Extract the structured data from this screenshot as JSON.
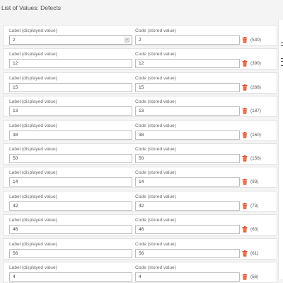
{
  "page": {
    "title": "List of Values: Defects"
  },
  "fields": {
    "label_caption": "Label (displayed value)",
    "code_caption": "Code (stored value)"
  },
  "colors": {
    "delete_icon": "#e0481f",
    "input_border": "#bdbdbd",
    "background": "#f4f4f4"
  },
  "rows": [
    {
      "label": "2",
      "code": "2",
      "count": "(530)"
    },
    {
      "label": "12",
      "code": "12",
      "count": "(390)"
    },
    {
      "label": "15",
      "code": "15",
      "count": "(288)"
    },
    {
      "label": "13",
      "code": "13",
      "count": "(187)"
    },
    {
      "label": "38",
      "code": "38",
      "count": "(160)"
    },
    {
      "label": "50",
      "code": "50",
      "count": "(156)"
    },
    {
      "label": "14",
      "code": "14",
      "count": "(93)"
    },
    {
      "label": "42",
      "code": "42",
      "count": "(73)"
    },
    {
      "label": "46",
      "code": "46",
      "count": "(63)"
    },
    {
      "label": "56",
      "code": "56",
      "count": "(61)"
    },
    {
      "label": "4",
      "code": "4",
      "count": "(56)"
    }
  ]
}
